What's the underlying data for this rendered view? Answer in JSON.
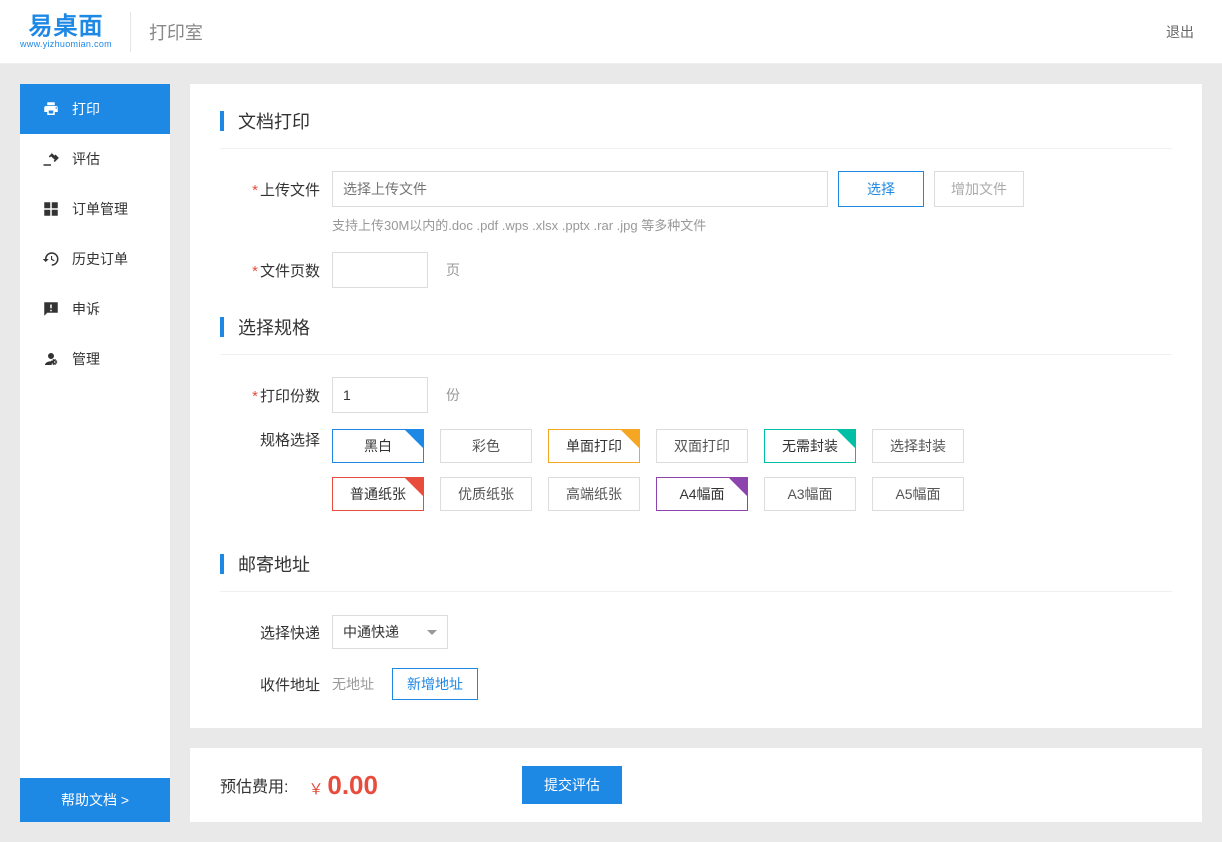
{
  "header": {
    "brand_main": "易桌面",
    "brand_sub": "www.yizhuomian.com",
    "title": "打印室",
    "logout": "退出"
  },
  "sidebar": {
    "items": [
      {
        "label": "打印",
        "key": "print"
      },
      {
        "label": "评估",
        "key": "evaluate"
      },
      {
        "label": "订单管理",
        "key": "orders"
      },
      {
        "label": "历史订单",
        "key": "history"
      },
      {
        "label": "申诉",
        "key": "appeal"
      },
      {
        "label": "管理",
        "key": "admin"
      }
    ],
    "help": "帮助文档 >"
  },
  "section_doc": {
    "title": "文档打印",
    "upload_label": "上传文件",
    "upload_placeholder": "选择上传文件",
    "choose_btn": "选择",
    "add_btn": "增加文件",
    "hint": "支持上传30M以内的.doc .pdf .wps .xlsx .pptx .rar .jpg 等多种文件",
    "pages_label": "文件页数",
    "pages_unit": "页"
  },
  "section_spec": {
    "title": "选择规格",
    "copies_label": "打印份数",
    "copies_value": "1",
    "copies_unit": "份",
    "spec_label": "规格选择",
    "row1": [
      "黑白",
      "彩色",
      "单面打印",
      "双面打印",
      "无需封装",
      "选择封装"
    ],
    "row2": [
      "普通纸张",
      "优质纸张",
      "高端纸张",
      "A4幅面",
      "A3幅面",
      "A5幅面"
    ]
  },
  "section_ship": {
    "title": "邮寄地址",
    "courier_label": "选择快递",
    "courier_selected": "中通快递",
    "addr_label": "收件地址",
    "addr_none": "无地址",
    "add_addr_btn": "新增地址"
  },
  "footer": {
    "cost_label": "预估费用:",
    "currency": "￥",
    "cost_value": "0.00",
    "submit": "提交评估"
  }
}
